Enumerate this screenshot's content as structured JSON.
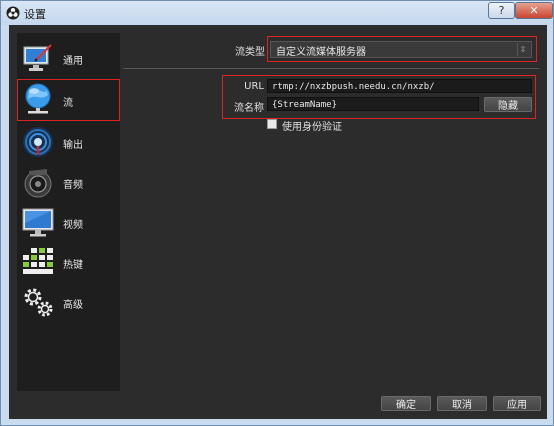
{
  "window": {
    "title": "设置",
    "help_label": "?",
    "close_label": "✕"
  },
  "sidebar": {
    "items": [
      {
        "label": "通用",
        "icon": "monitor-pen-icon",
        "selected": false
      },
      {
        "label": "流",
        "icon": "globe-network-icon",
        "selected": true
      },
      {
        "label": "输出",
        "icon": "broadcast-icon",
        "selected": false
      },
      {
        "label": "音频",
        "icon": "speaker-icon",
        "selected": false
      },
      {
        "label": "视频",
        "icon": "display-icon",
        "selected": false
      },
      {
        "label": "热键",
        "icon": "keyboard-icon",
        "selected": false
      },
      {
        "label": "高级",
        "icon": "gears-icon",
        "selected": false
      }
    ]
  },
  "stream": {
    "type_label": "流类型",
    "type_value": "自定义流媒体服务器",
    "url_label": "URL",
    "url_value": "rtmp://nxzbpush.needu.cn/nxzb/",
    "key_label": "流名称",
    "key_value": "{StreamName}",
    "hide_button": "隐藏",
    "auth_label": "使用身份验证",
    "auth_checked": false
  },
  "footer": {
    "ok": "确定",
    "cancel": "取消",
    "apply": "应用"
  },
  "colors": {
    "highlight_box": "#dd2222",
    "panel_bg": "#2c2c2c",
    "sidebar_bg": "#1e1e1e"
  }
}
